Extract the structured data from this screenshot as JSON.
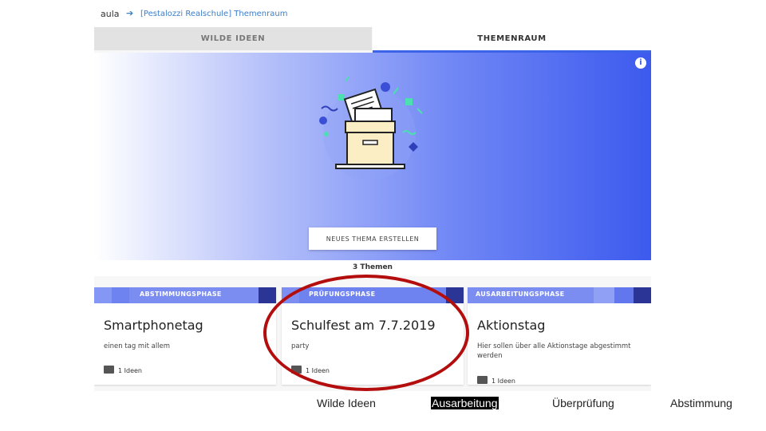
{
  "topbar": {
    "logo": "aula",
    "arrow": "➔",
    "breadcrumb": "[Pestalozzi Realschule] Themenraum"
  },
  "tabs": [
    {
      "label": "WILDE IDEEN",
      "active": false
    },
    {
      "label": "THEMENRAUM",
      "active": true
    }
  ],
  "hero": {
    "info": "i",
    "button_label": "NEUES THEMA ERSTELLEN"
  },
  "topic_count": "3 Themen",
  "cards": [
    {
      "phase": "ABSTIMMUNGSPHASE",
      "title": "Smartphonetag",
      "description": "einen tag mit allem",
      "ideas": "1 Ideen"
    },
    {
      "phase": "PRÜFUNGSPHASE",
      "title": "Schulfest am 7.7.2019",
      "description": "party",
      "ideas": "1 Ideen"
    },
    {
      "phase": "AUSARBEITUNGSPHASE",
      "title": "Aktionstag",
      "description": "Hier sollen über alle Aktionstage abgestimmt werden",
      "ideas": "1 Ideen"
    }
  ],
  "legend": [
    "Wilde Ideen",
    "Ausarbeitung",
    "Überprüfung",
    "Abstimmung"
  ],
  "colors": {
    "accent": "#3d63e8",
    "highlight_oval": "#b40d0d"
  }
}
